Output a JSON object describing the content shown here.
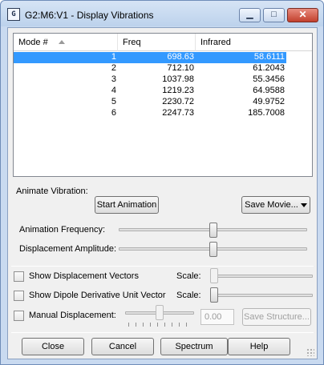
{
  "window": {
    "title": "G2:M6:V1 - Display Vibrations",
    "app_icon_text": "G",
    "min_glyph": "▁",
    "max_glyph": "□",
    "close_glyph": "✕"
  },
  "table": {
    "headers": [
      "Mode #",
      "Freq",
      "Infrared"
    ],
    "sort_column": "Mode #",
    "selected_row": 0,
    "rows": [
      [
        "1",
        "698.63",
        "58.6111"
      ],
      [
        "2",
        "712.10",
        "61.2043"
      ],
      [
        "3",
        "1037.98",
        "55.3456"
      ],
      [
        "4",
        "1219.23",
        "64.9588"
      ],
      [
        "5",
        "2230.72",
        "49.9752"
      ],
      [
        "6",
        "2247.73",
        "185.7008"
      ]
    ]
  },
  "animate": {
    "label": "Animate Vibration:",
    "start_button": "Start Animation",
    "save_movie_button": "Save Movie...",
    "frequency_label": "Animation Frequency:",
    "frequency_level": 0.5,
    "amplitude_label": "Displacement Amplitude:",
    "amplitude_level": 0.5
  },
  "options": {
    "show_vectors_label": "Show Displacement Vectors",
    "show_vectors_checked": false,
    "show_vectors_scale_label": "Scale:",
    "show_vectors_scale_level": 0.0,
    "show_dipole_label": "Show Dipole Derivative Unit Vector",
    "show_dipole_checked": false,
    "show_dipole_scale_label": "Scale:",
    "show_dipole_scale_level": 0.0,
    "manual_label": "Manual Displacement:",
    "manual_checked": false,
    "manual_level": 0.5,
    "manual_value": "0.00",
    "save_structure_button": "Save Structure..."
  },
  "footer": {
    "close": "Close",
    "cancel": "Cancel",
    "spectrum": "Spectrum",
    "help": "Help"
  }
}
